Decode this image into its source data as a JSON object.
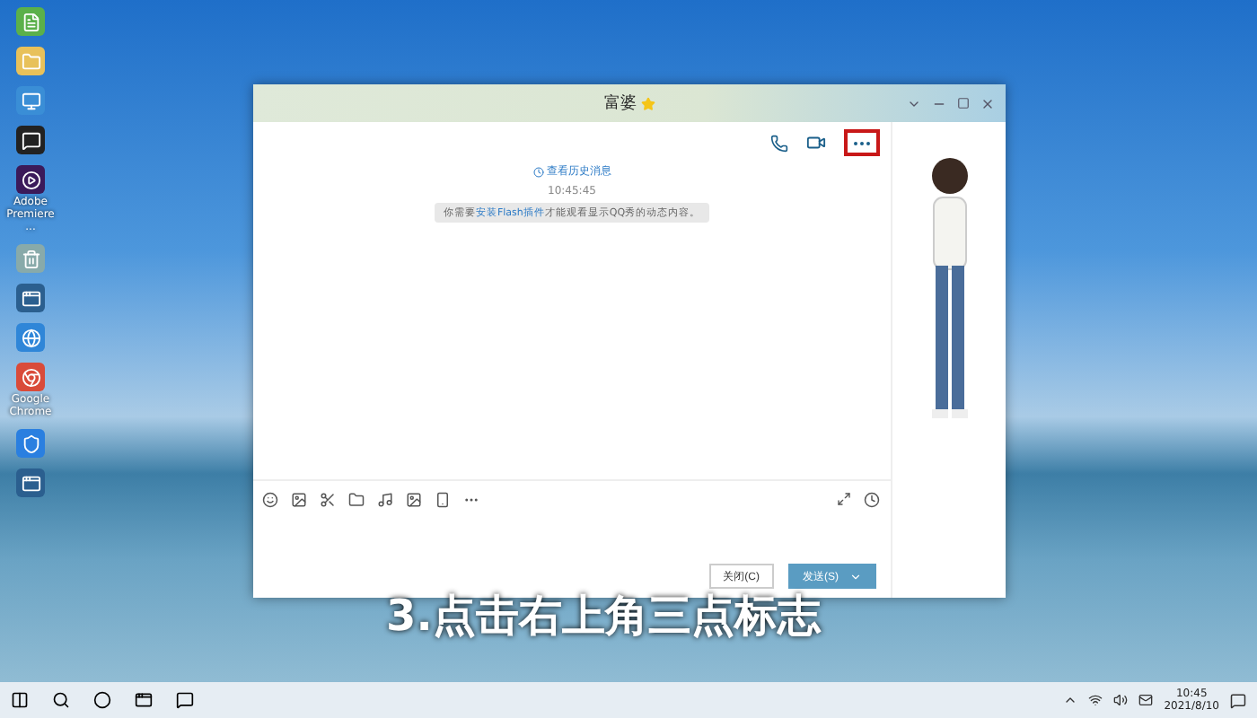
{
  "desktop_icons": [
    {
      "kind": "file"
    },
    {
      "kind": "folder"
    },
    {
      "kind": "monitor"
    },
    {
      "kind": "penguin"
    },
    {
      "kind": "premiere",
      "label": "Adobe Premiere ..."
    },
    {
      "kind": "recycle"
    },
    {
      "kind": "app"
    },
    {
      "kind": "browser"
    },
    {
      "kind": "chrome",
      "label": "Google Chrome"
    },
    {
      "kind": "shield"
    },
    {
      "kind": "app"
    }
  ],
  "chat_window": {
    "title": "富婆",
    "starred": true,
    "history_link": "查看历史消息",
    "time": "10:45:45",
    "notice": {
      "before": "你需要",
      "link": "安装Flash插件",
      "after": "才能观看显示QQ秀的动态内容。"
    },
    "more_button_highlighted": true,
    "buttons": [
      {
        "label": "关闭(C)",
        "kind": "plain"
      },
      {
        "label": "发送(S)",
        "kind": "primary"
      }
    ]
  },
  "caption": "3.点击右上角三点标志",
  "taskbar": {
    "time": "10:45",
    "date": "2021/8/10"
  }
}
